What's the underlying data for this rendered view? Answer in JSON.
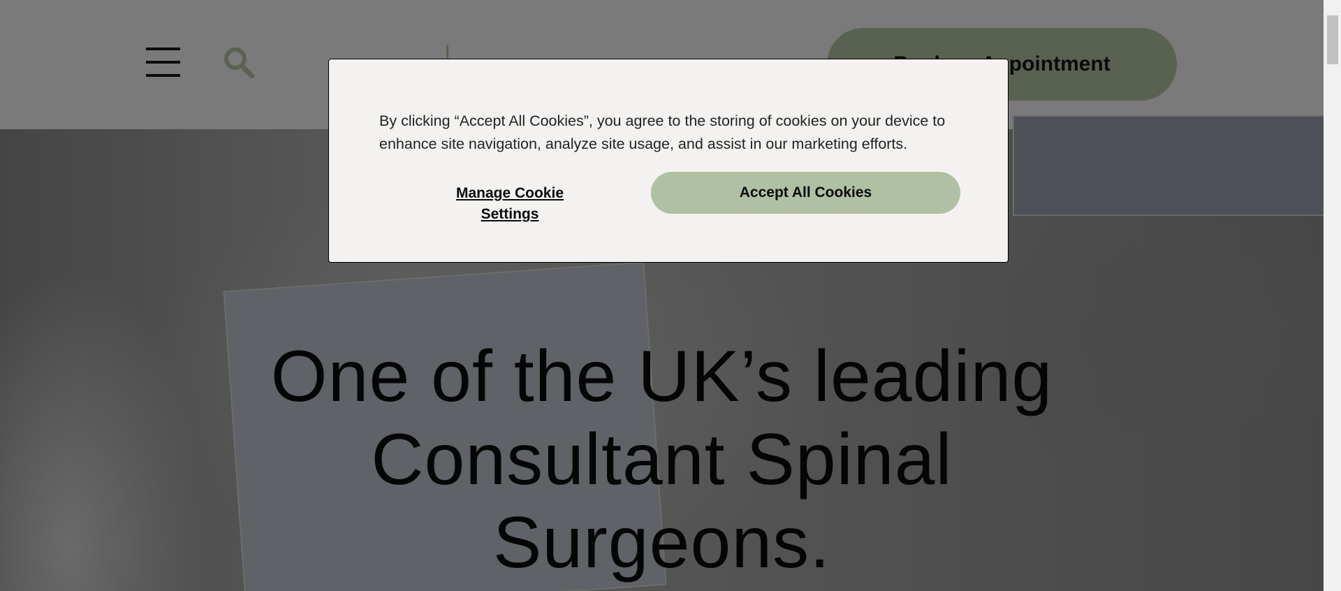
{
  "header": {
    "menu_icon": "hamburger-icon",
    "search_icon": "search-icon",
    "book_button_label": "Book an Appointment"
  },
  "hero": {
    "headline_lines": [
      "One of the UK’s leading",
      "Consultant Spinal",
      "Surgeons."
    ]
  },
  "cookie_banner": {
    "message": "By clicking “Accept All Cookies”, you agree to the storing of cookies on your device to enhance site navigation, analyze site usage, and assist in our marketing efforts.",
    "manage_label": "Manage Cookie Settings",
    "accept_label": "Accept All Cookies",
    "accept_color": "#afc0a3",
    "background_color": "#f3f2f0"
  },
  "colors": {
    "brand_green": "#596150",
    "overlay": "#7a7a7a"
  }
}
